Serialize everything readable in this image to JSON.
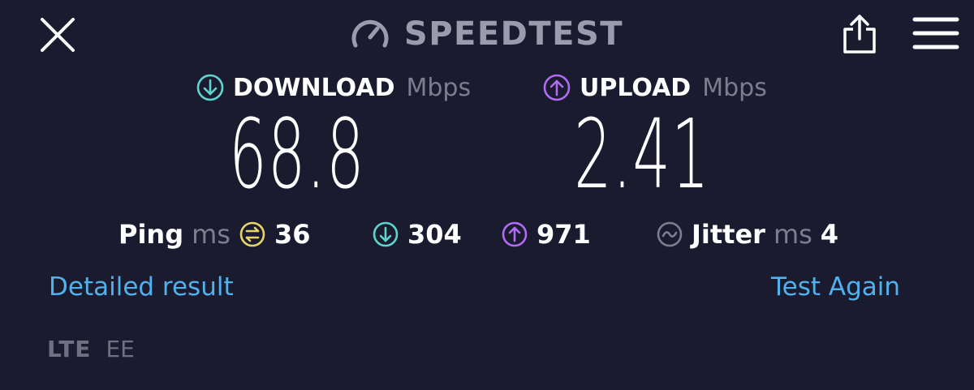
{
  "header": {
    "brand": "SPEEDTEST",
    "icons": {
      "close": "close-icon",
      "logo": "speedometer-icon",
      "share": "share-icon",
      "menu": "hamburger-menu-icon"
    }
  },
  "download": {
    "label": "DOWNLOAD",
    "unit": "Mbps",
    "value": "68.8",
    "color": "#5fd4cf"
  },
  "upload": {
    "label": "UPLOAD",
    "unit": "Mbps",
    "value": "2.41",
    "color": "#b06bf0"
  },
  "stats": {
    "ping_label": "Ping",
    "ping_unit": "ms",
    "ping_value": "36",
    "ping_color": "#e6d56a",
    "download_ping": "304",
    "upload_ping": "971",
    "jitter_label": "Jitter",
    "jitter_unit": "ms",
    "jitter_value": "4"
  },
  "actions": {
    "detailed": "Detailed result",
    "again": "Test Again",
    "link_color": "#52b0ec"
  },
  "network": {
    "type": "LTE",
    "carrier": "EE"
  }
}
